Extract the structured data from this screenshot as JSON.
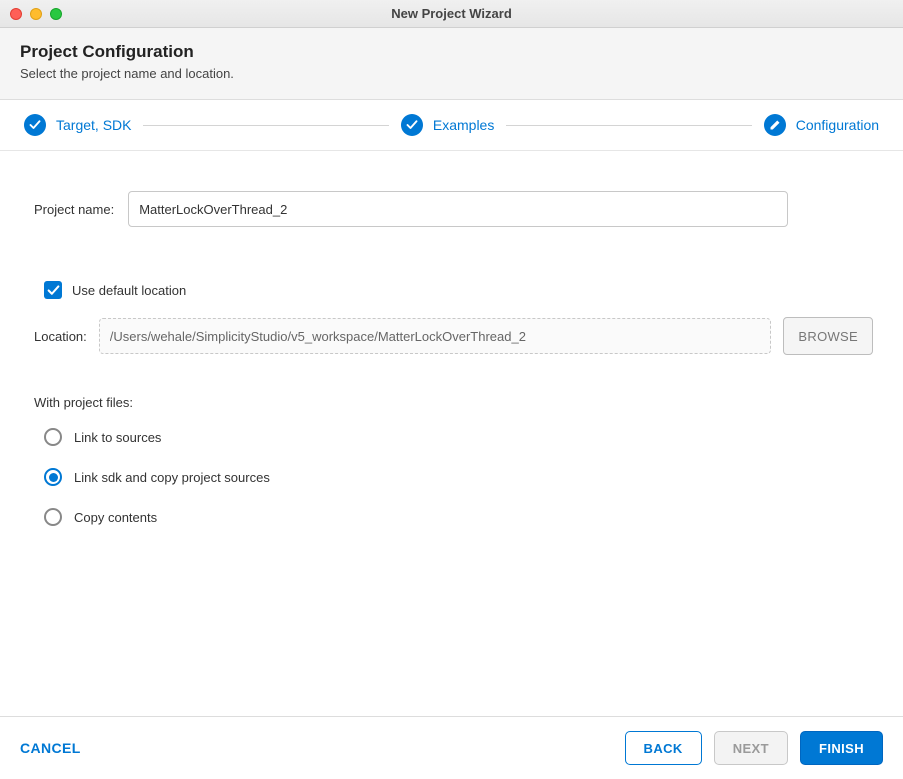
{
  "window": {
    "title": "New Project Wizard"
  },
  "header": {
    "title": "Project Configuration",
    "subtitle": "Select the project name and location."
  },
  "stepper": {
    "steps": [
      {
        "label": "Target, SDK",
        "icon": "check"
      },
      {
        "label": "Examples",
        "icon": "check"
      },
      {
        "label": "Configuration",
        "icon": "pencil"
      }
    ]
  },
  "form": {
    "projectNameLabel": "Project name:",
    "projectNameValue": "MatterLockOverThread_2",
    "useDefaultLabel": "Use default location",
    "useDefaultChecked": true,
    "locationLabel": "Location:",
    "locationValue": "/Users/wehale/SimplicityStudio/v5_workspace/MatterLockOverThread_2",
    "browseLabel": "BROWSE",
    "projectFilesLabel": "With project files:",
    "radioOptions": [
      {
        "label": "Link to sources",
        "selected": false
      },
      {
        "label": "Link sdk and copy project sources",
        "selected": true
      },
      {
        "label": "Copy contents",
        "selected": false
      }
    ]
  },
  "footer": {
    "cancel": "CANCEL",
    "back": "BACK",
    "next": "NEXT",
    "finish": "FINISH"
  }
}
